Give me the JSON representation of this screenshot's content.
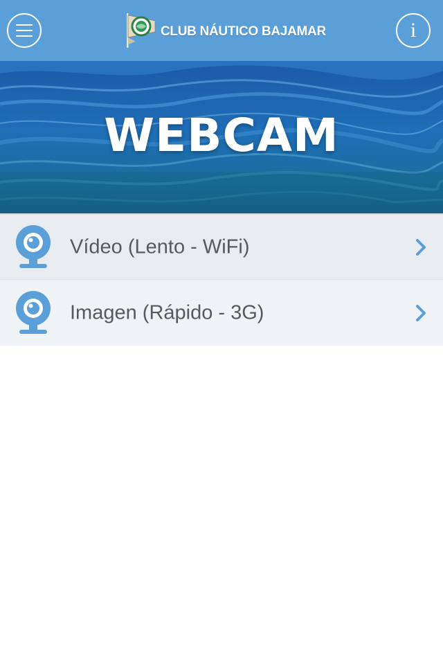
{
  "header": {
    "club_name": "CLUB NÁUTICO BAJAMAR",
    "menu_icon": "hamburger-menu-icon",
    "info_icon": "info-icon",
    "info_glyph": "i",
    "background_color": "#5b9fd9"
  },
  "hero": {
    "title": "WEBCAM"
  },
  "list": {
    "items": [
      {
        "label": "Vídeo (Lento - WiFi)",
        "icon": "webcam-icon"
      },
      {
        "label": "Imagen (Rápido - 3G)",
        "icon": "webcam-icon"
      }
    ]
  },
  "colors": {
    "accent": "#5b9fd9",
    "item_text": "#555a60",
    "row_bg_1": "#e8ecf0",
    "row_bg_2": "#f0f3f6"
  }
}
